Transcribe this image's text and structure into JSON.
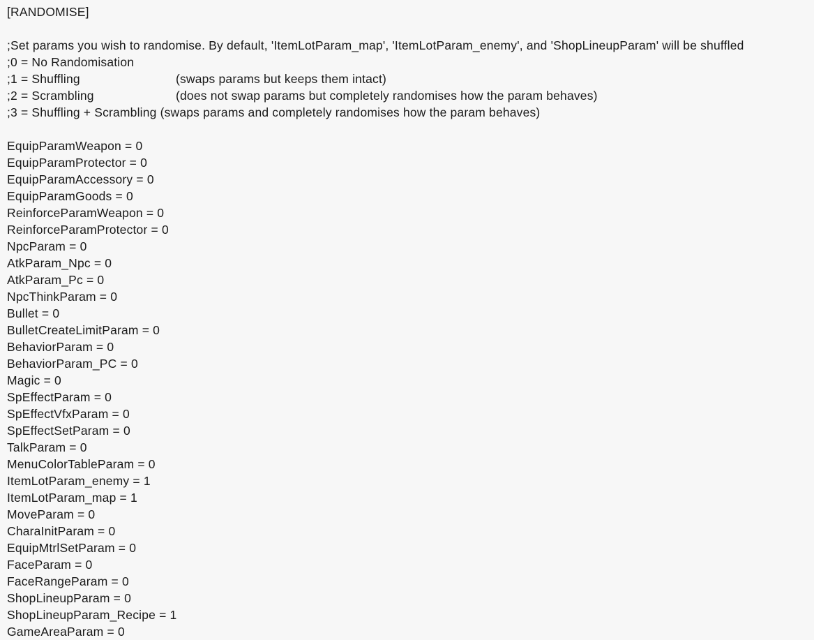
{
  "document": {
    "section_header": "[RANDOMISE]",
    "background_color": "#f7f7f7",
    "text_color": "#1a1a1a",
    "comments": [
      {
        "label": ";Set params you wish to randomise. By default, 'ItemLotParam_map', 'ItemLotParam_enemy', and 'ShopLineupParam' will be shuffled",
        "note": ""
      },
      {
        "label": ";0 = No Randomisation",
        "note": ""
      },
      {
        "label": ";1 = Shuffling",
        "note": "(swaps params but keeps them intact)"
      },
      {
        "label": ";2 = Scrambling",
        "note": "(does not swap params but completely randomises how the param behaves)"
      },
      {
        "label": ";3 = Shuffling + Scrambling ",
        "note": "(swaps params and completely randomises how the param behaves)"
      }
    ],
    "params": [
      {
        "key": "EquipParamWeapon",
        "value": "0"
      },
      {
        "key": "EquipParamProtector",
        "value": "0"
      },
      {
        "key": "EquipParamAccessory",
        "value": "0"
      },
      {
        "key": "EquipParamGoods",
        "value": "0"
      },
      {
        "key": "ReinforceParamWeapon",
        "value": "0"
      },
      {
        "key": "ReinforceParamProtector",
        "value": "0"
      },
      {
        "key": "NpcParam",
        "value": "0"
      },
      {
        "key": "AtkParam_Npc",
        "value": "0"
      },
      {
        "key": "AtkParam_Pc",
        "value": "0"
      },
      {
        "key": "NpcThinkParam",
        "value": "0"
      },
      {
        "key": "Bullet",
        "value": "0"
      },
      {
        "key": "BulletCreateLimitParam",
        "value": "0"
      },
      {
        "key": "BehaviorParam",
        "value": "0"
      },
      {
        "key": "BehaviorParam_PC",
        "value": "0"
      },
      {
        "key": "Magic",
        "value": "0"
      },
      {
        "key": "SpEffectParam",
        "value": "0"
      },
      {
        "key": "SpEffectVfxParam",
        "value": "0"
      },
      {
        "key": "SpEffectSetParam",
        "value": "0"
      },
      {
        "key": "TalkParam",
        "value": "0"
      },
      {
        "key": "MenuColorTableParam",
        "value": "0"
      },
      {
        "key": "ItemLotParam_enemy",
        "value": "1"
      },
      {
        "key": "ItemLotParam_map",
        "value": "1"
      },
      {
        "key": "MoveParam",
        "value": "0"
      },
      {
        "key": "CharaInitParam",
        "value": "0"
      },
      {
        "key": "EquipMtrlSetParam",
        "value": "0"
      },
      {
        "key": "FaceParam",
        "value": "0"
      },
      {
        "key": "FaceRangeParam",
        "value": "0"
      },
      {
        "key": "ShopLineupParam",
        "value": "0"
      },
      {
        "key": "ShopLineupParam_Recipe",
        "value": "1"
      },
      {
        "key": "GameAreaParam",
        "value": "0"
      }
    ],
    "separator": " = "
  }
}
